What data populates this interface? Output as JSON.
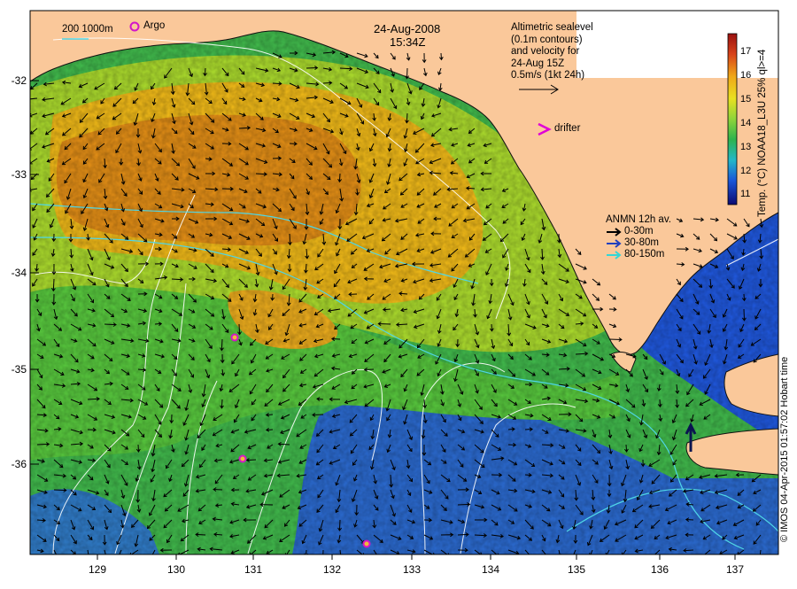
{
  "map": {
    "date": "24-Aug-2008",
    "time": "15:34Z",
    "argo_label": "Argo",
    "depth_scale_label": "200  1000m",
    "altimetry_note": [
      "Altimetric sealevel",
      "(0.1m contours)",
      "and velocity for",
      "24-Aug 15Z",
      "0.5m/s (1kt 24h)"
    ],
    "drifter_label": "drifter",
    "anmn": {
      "title": "ANMN 12h av.",
      "items": [
        {
          "label": "0-30m",
          "color": "#000000"
        },
        {
          "label": "30-80m",
          "color": "#1f3fbf"
        },
        {
          "label": "80-150m",
          "color": "#33d6d6"
        }
      ]
    },
    "colorbar": {
      "label": "Temp. (°C) NOAA18_L3U 25% ql>=4",
      "ticks": [
        "17",
        "16",
        "15",
        "14",
        "13",
        "12",
        "11"
      ]
    },
    "credit": "© IMOS 04-Apr-2015 01:57:02 Hobart time",
    "lat_ticks": [
      "-32",
      "-33",
      "-34",
      "-35",
      "-36"
    ],
    "lon_ticks": [
      "129",
      "130",
      "131",
      "132",
      "133",
      "134",
      "135",
      "136",
      "137"
    ],
    "colors": {
      "land": "#fac89a",
      "warm": "#e28a14",
      "mid": "#8dd43a",
      "cool": "#3bb34a",
      "cold": "#1d4fd1"
    }
  }
}
